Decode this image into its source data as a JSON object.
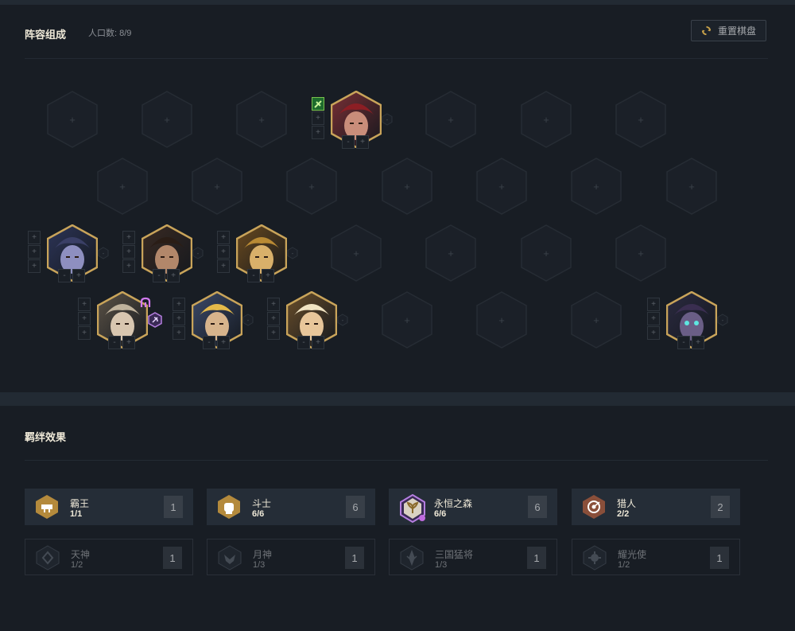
{
  "composition": {
    "title": "阵容组成",
    "population_label": "人口数: 8/9",
    "reset_button": "重置棋盘"
  },
  "board": {
    "empty_symbol": "+",
    "level_minus": "-",
    "level_plus": "+"
  },
  "traits_section": {
    "title": "羁绊效果",
    "active": [
      {
        "name": "霸王",
        "progress": "1/1",
        "count": "1",
        "color": "#b48a3c",
        "icon": "overlord-icon"
      },
      {
        "name": "斗士",
        "progress": "6/6",
        "count": "6",
        "color": "#b48a3c",
        "icon": "fist-icon"
      },
      {
        "name": "永恒之森",
        "progress": "6/6",
        "count": "6",
        "color": "#9b5fc0",
        "icon": "leaf-icon"
      },
      {
        "name": "猎人",
        "progress": "2/2",
        "count": "2",
        "color": "#8a4f3a",
        "icon": "target-icon"
      }
    ],
    "inactive": [
      {
        "name": "天神",
        "progress": "1/2",
        "count": "1",
        "icon": "divine-icon"
      },
      {
        "name": "月神",
        "progress": "1/3",
        "count": "1",
        "icon": "moon-icon"
      },
      {
        "name": "三国猛将",
        "progress": "1/3",
        "count": "1",
        "icon": "warlord-icon"
      },
      {
        "name": "耀光使",
        "progress": "1/2",
        "count": "1",
        "icon": "radiant-icon"
      }
    ]
  }
}
